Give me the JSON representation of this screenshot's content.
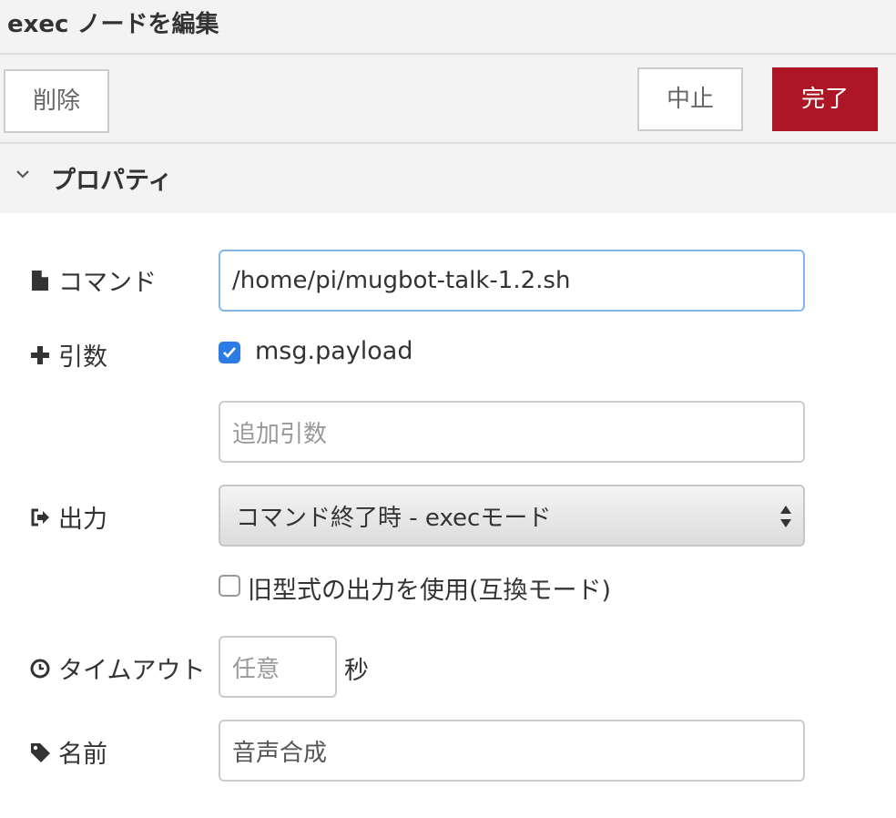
{
  "dialog": {
    "title": "exec ノードを編集"
  },
  "toolbar": {
    "delete_label": "削除",
    "cancel_label": "中止",
    "done_label": "完了"
  },
  "section": {
    "title": "プロパティ"
  },
  "fields": {
    "command": {
      "label": "コマンド",
      "value": "/home/pi/mugbot-talk-1.2.sh",
      "icon": "file-icon"
    },
    "args": {
      "label": "引数",
      "icon": "plus-icon",
      "append_checked": true,
      "append_label": "msg.payload",
      "extra_placeholder": "追加引数",
      "extra_value": ""
    },
    "output": {
      "label": "出力",
      "icon": "sign-out-icon",
      "selected": "コマンド終了時 - execモード",
      "legacy_checked": false,
      "legacy_label": "旧型式の出力を使用(互換モード)"
    },
    "timeout": {
      "label": "タイムアウト",
      "icon": "clock-icon",
      "placeholder": "任意",
      "value": "",
      "unit": "秒"
    },
    "name": {
      "label": "名前",
      "icon": "tag-icon",
      "value": "音声合成"
    }
  },
  "colors": {
    "accent": "#ad1625",
    "focus_border": "#85b7e8",
    "checkbox": "#2d7be5"
  }
}
